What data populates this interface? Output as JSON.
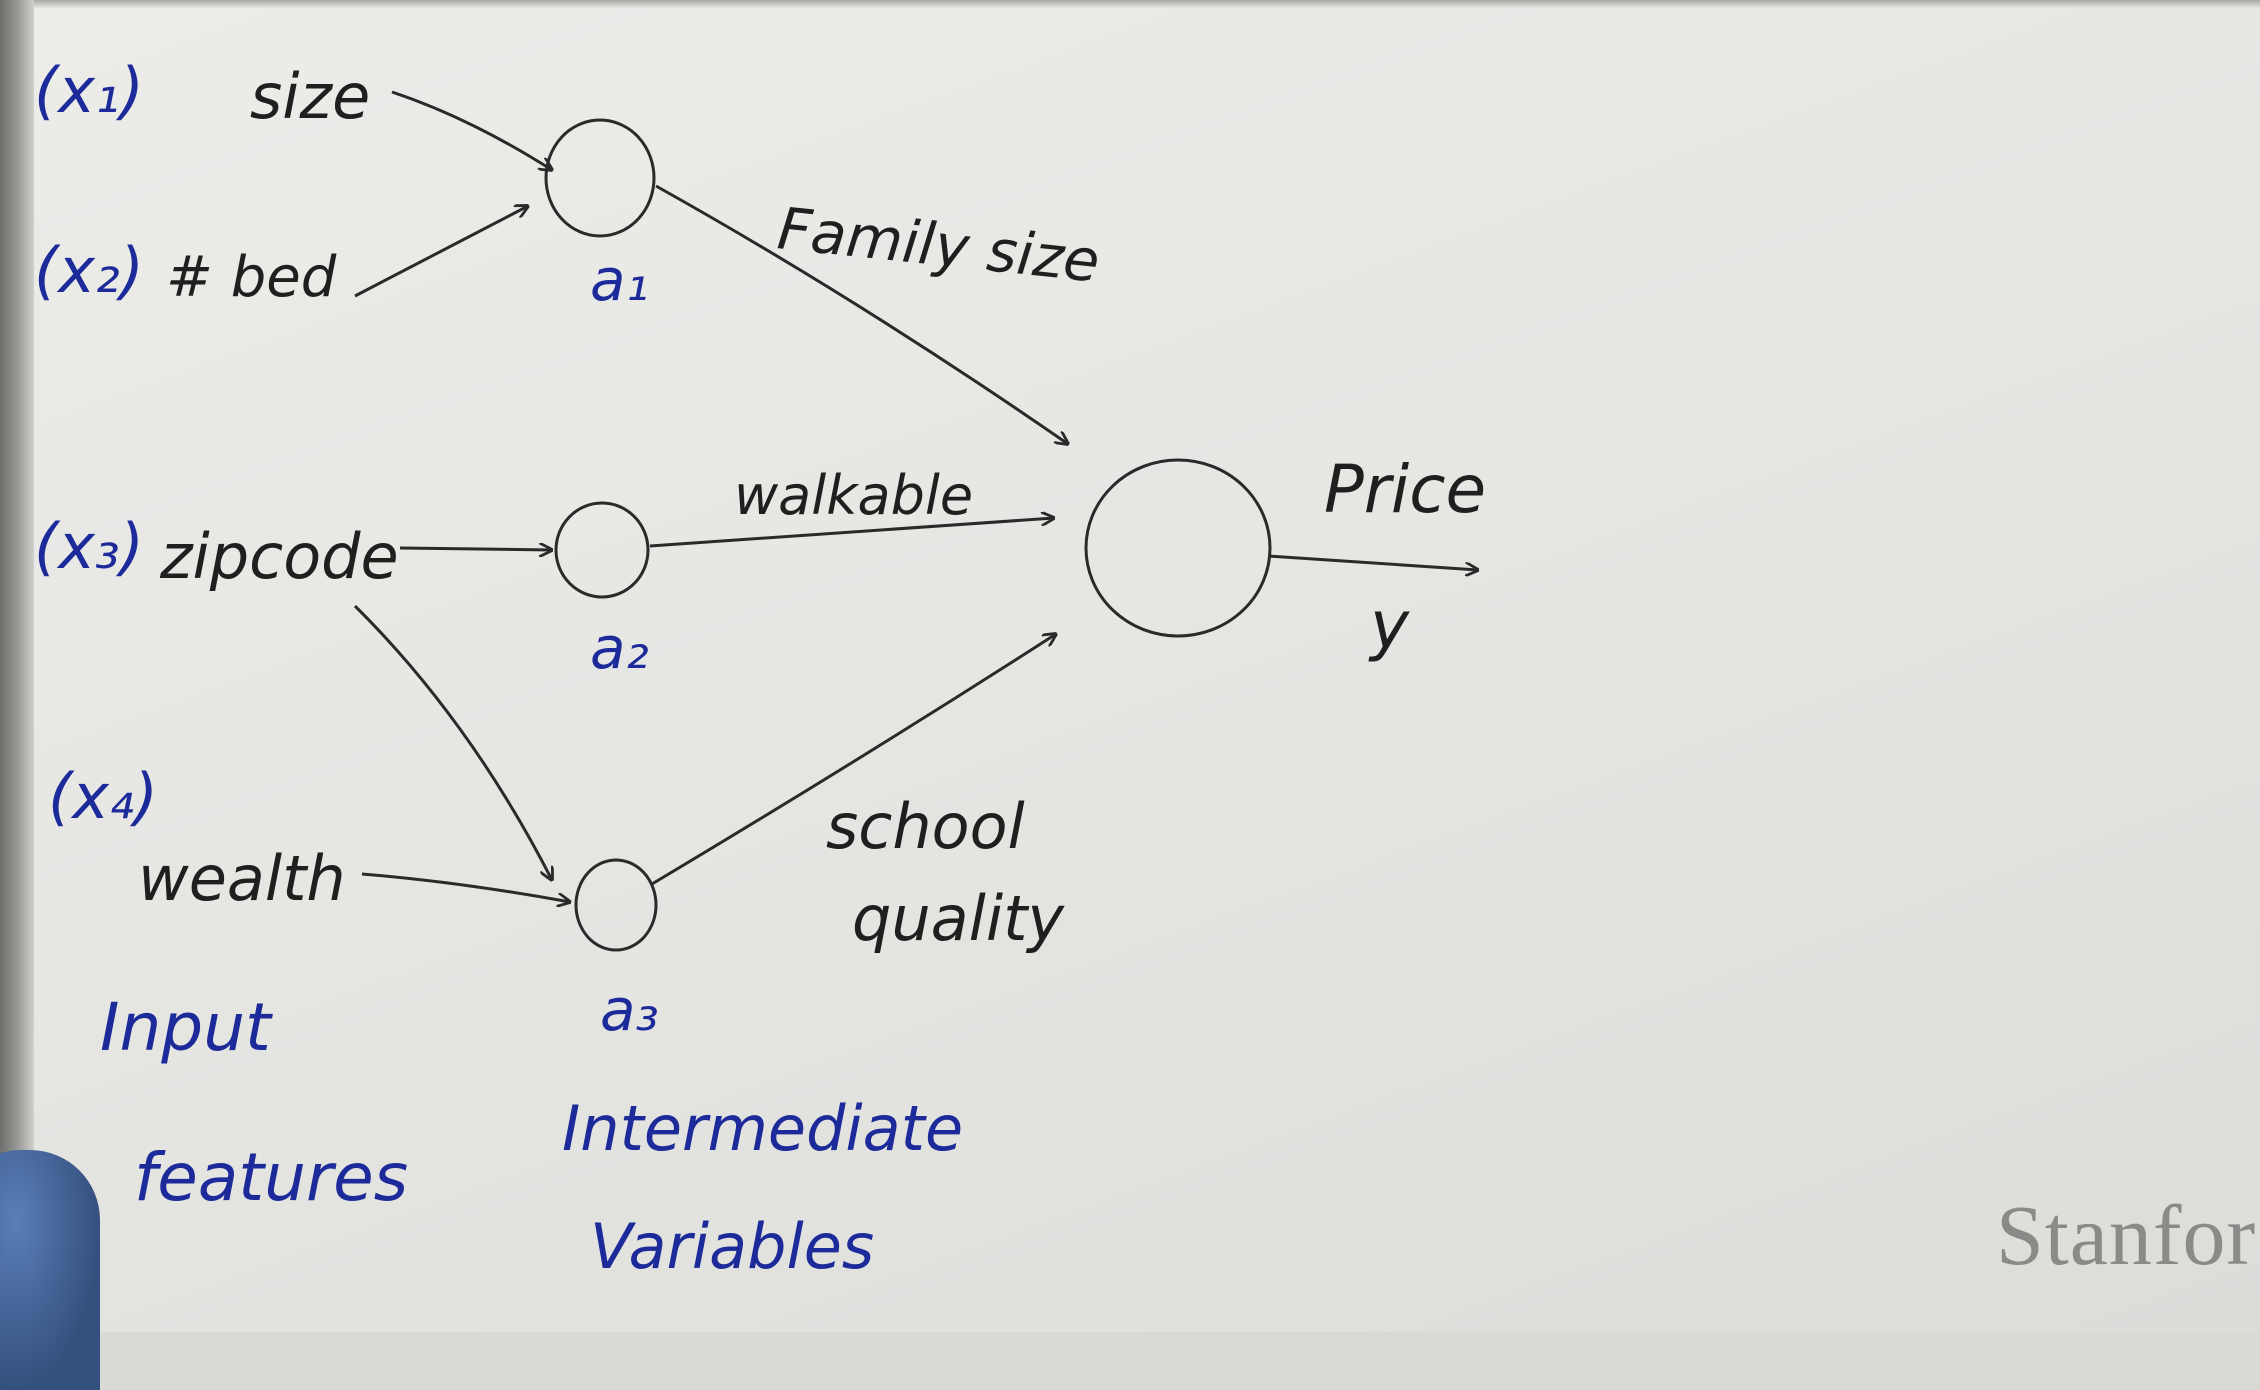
{
  "inputs": [
    {
      "var": "(x₁)",
      "name": "size"
    },
    {
      "var": "(x₂)",
      "name": "# bed"
    },
    {
      "var": "(x₃)",
      "name": "zipcode"
    },
    {
      "var": "(x₄)",
      "name": "wealth"
    }
  ],
  "hidden": [
    {
      "label": "a₁",
      "feature": "Family size"
    },
    {
      "label": "a₂",
      "feature": "walkable"
    },
    {
      "label": "a₃",
      "feature_line1": "school",
      "feature_line2": "quality"
    }
  ],
  "output": {
    "name": "Price",
    "symbol": "y"
  },
  "annotations": {
    "inputs_line1": "Input",
    "inputs_line2": "features",
    "hidden_line1": "Intermediate",
    "hidden_line2": "Variables"
  },
  "watermark": "Stanfor",
  "colors": {
    "black_ink": "#1f1f1f",
    "blue_ink": "#1c2a9a",
    "board": "#e6e6e3"
  }
}
